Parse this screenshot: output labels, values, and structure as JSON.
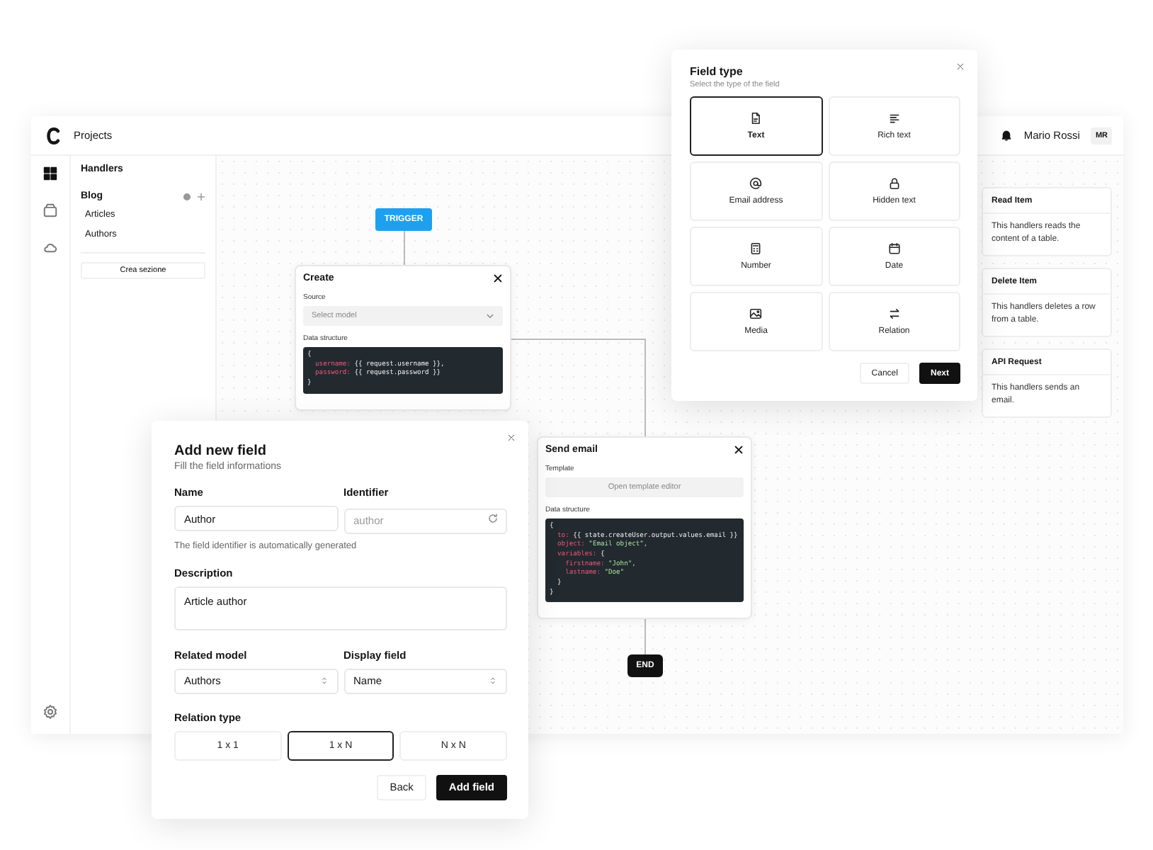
{
  "header": {
    "title": "Projects",
    "user_name": "Mario Rossi",
    "user_initials": "MR"
  },
  "rail": [
    {
      "kind": "grid",
      "selected": true
    },
    {
      "kind": "box",
      "selected": false
    },
    {
      "kind": "cloud",
      "selected": false
    }
  ],
  "sidebar": {
    "title": "Handlers",
    "section": "Blog",
    "items": [
      "Articles",
      "Authors"
    ],
    "create_button": "Crea sezione"
  },
  "handlers": [
    {
      "title": "Read Item",
      "description": "This handlers reads the content of a table."
    },
    {
      "title": "Delete Item",
      "description": "This handlers deletes a row from a table."
    },
    {
      "title": "API Request",
      "description": "This handlers sends an email."
    }
  ],
  "flow": {
    "trigger": "TRIGGER",
    "end": "END",
    "create_node": {
      "title": "Create",
      "source_label": "Source",
      "source_placeholder": "Select model",
      "data_label": "Data structure",
      "code": [
        [
          {
            "kind": "plain",
            "text": "{"
          }
        ],
        [
          {
            "kind": "key",
            "text": "  username:"
          },
          {
            "kind": "plain",
            "text": " {{ request.username }},"
          }
        ],
        [
          {
            "kind": "key",
            "text": "  password:"
          },
          {
            "kind": "plain",
            "text": " {{ request.password }}"
          }
        ],
        [
          {
            "kind": "plain",
            "text": "}"
          }
        ]
      ]
    },
    "email_node": {
      "title": "Send email",
      "template_label": "Template",
      "template_button": "Open template editor",
      "data_label": "Data structure",
      "code": [
        [
          {
            "kind": "plain",
            "text": "{"
          }
        ],
        [
          {
            "kind": "key",
            "text": "  to:"
          },
          {
            "kind": "plain",
            "text": " {{ state.createUser.output.values.email }}"
          }
        ],
        [
          {
            "kind": "key",
            "text": "  object:"
          },
          {
            "kind": "string",
            "text": " \"Email object\","
          }
        ],
        [
          {
            "kind": "key",
            "text": "  variables:"
          },
          {
            "kind": "plain",
            "text": " {"
          }
        ],
        [
          {
            "kind": "key",
            "text": "    firstname:"
          },
          {
            "kind": "string",
            "text": " \"John\","
          }
        ],
        [
          {
            "kind": "key",
            "text": "    lastname:"
          },
          {
            "kind": "string",
            "text": " \"Doe\""
          }
        ],
        [
          {
            "kind": "plain",
            "text": "  }"
          }
        ],
        [
          {
            "kind": "plain",
            "text": "}"
          }
        ]
      ]
    }
  },
  "field_type_dialog": {
    "title": "Field type",
    "subtitle": "Select the type of the field",
    "options": [
      {
        "kind": "text",
        "label": "Text",
        "selected": true
      },
      {
        "kind": "richtext",
        "label": "Rich text",
        "selected": false
      },
      {
        "kind": "email",
        "label": "Email address",
        "selected": false
      },
      {
        "kind": "lock",
        "label": "Hidden text",
        "selected": false
      },
      {
        "kind": "number",
        "label": "Number",
        "selected": false
      },
      {
        "kind": "date",
        "label": "Date",
        "selected": false
      },
      {
        "kind": "media",
        "label": "Media",
        "selected": false
      },
      {
        "kind": "relation",
        "label": "Relation",
        "selected": false
      }
    ],
    "cancel": "Cancel",
    "next": "Next"
  },
  "add_field_dialog": {
    "title": "Add new field",
    "subtitle": "Fill the field informations",
    "name_label": "Name",
    "name_value": "Author",
    "identifier_label": "Identifier",
    "identifier_placeholder": "author",
    "hint": "The field identifier is automatically generated",
    "description_label": "Description",
    "description_value": "Article author",
    "related_label": "Related model",
    "related_value": "Authors",
    "display_label": "Display field",
    "display_value": "Name",
    "relation_label": "Relation type",
    "relations": [
      {
        "label": "1 x 1",
        "selected": false
      },
      {
        "label": "1 x N",
        "selected": true
      },
      {
        "label": "N x N",
        "selected": false
      }
    ],
    "back": "Back",
    "submit": "Add field"
  }
}
